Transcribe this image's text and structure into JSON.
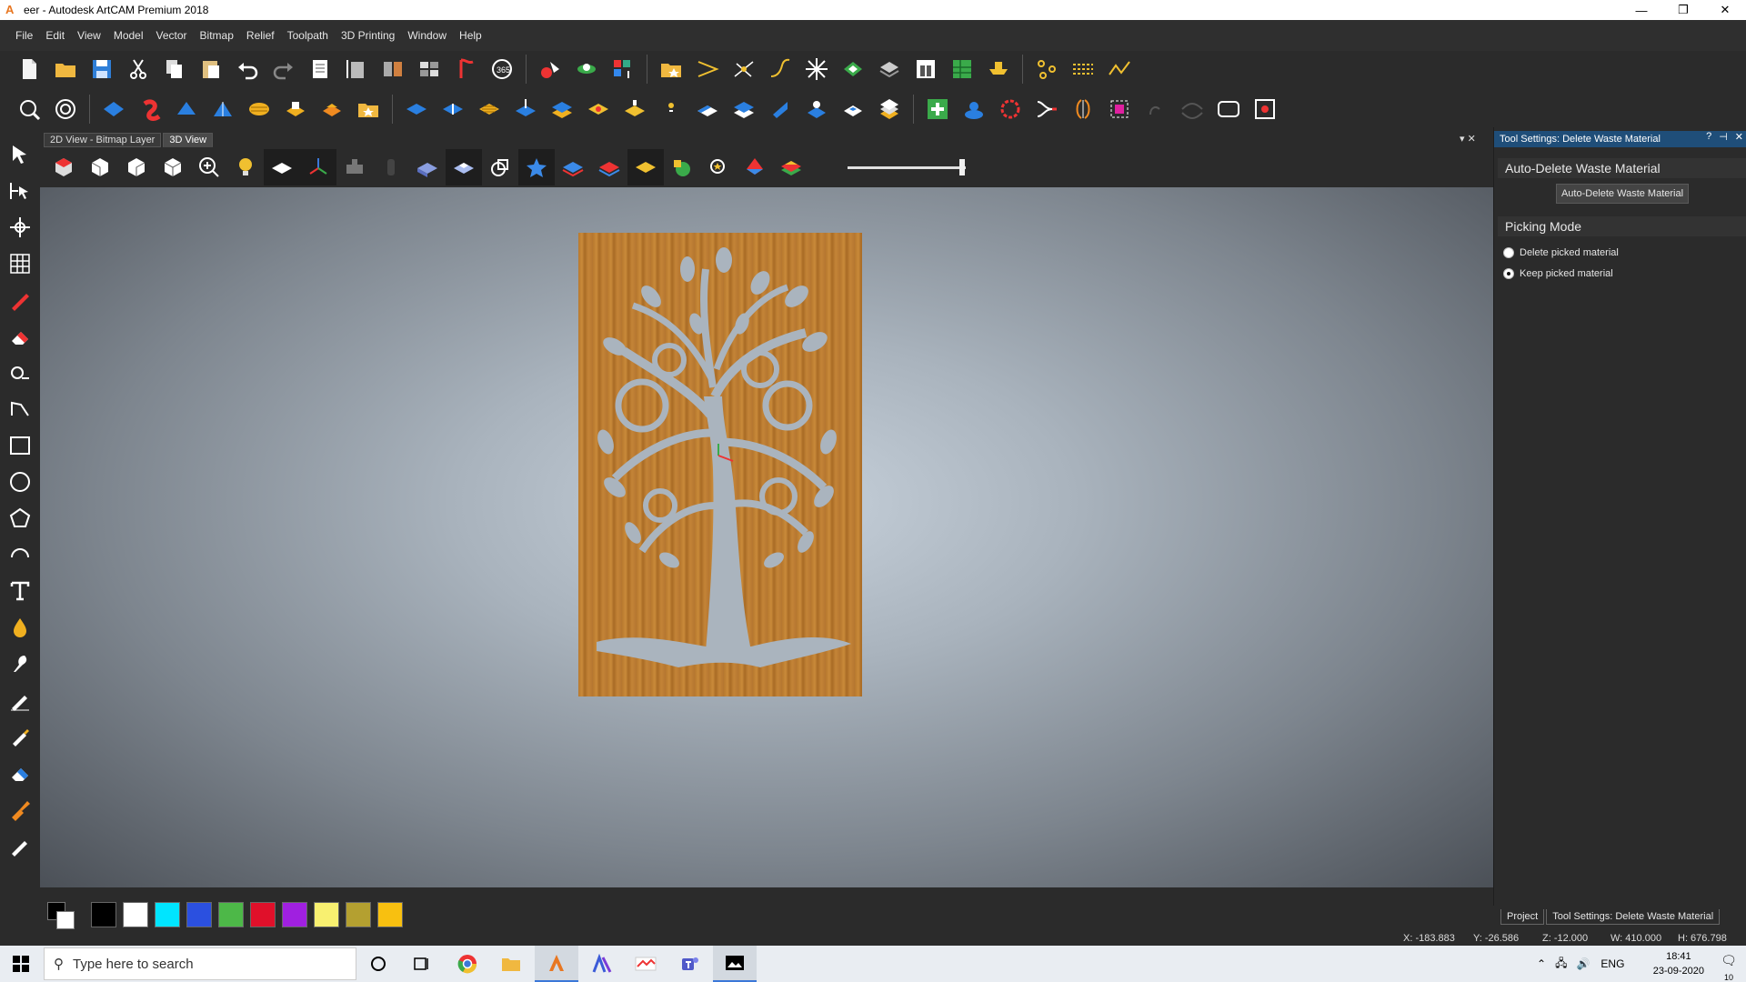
{
  "window": {
    "title": "eer - Autodesk ArtCAM Premium 2018",
    "minimize": "—",
    "restore": "❐",
    "close": "✕"
  },
  "menu": [
    "File",
    "Edit",
    "View",
    "Model",
    "Vector",
    "Bitmap",
    "Relief",
    "Toolpath",
    "3D Printing",
    "Window",
    "Help"
  ],
  "view_tabs": {
    "tab_2d": "2D View - Bitmap Layer",
    "tab_3d": "3D View"
  },
  "viewport": {
    "panel_colors": {
      "wood": "#c48437",
      "cutout": "#aab4be"
    }
  },
  "palette": {
    "colors": [
      "#000000",
      "#ffffff",
      "#00e5ff",
      "#2b50e0",
      "#4db848",
      "#e0102a",
      "#a020e0",
      "#f8f070",
      "#b4a030",
      "#f8c010"
    ]
  },
  "right_panel": {
    "header": "Tool Settings: Delete Waste Material",
    "header_buttons": [
      "?",
      "⊣",
      "✕"
    ],
    "pin_buttons": [
      "▾",
      "✕"
    ],
    "section_auto": "Auto-Delete Waste Material",
    "auto_button": "Auto-Delete Waste Material",
    "section_picking": "Picking Mode",
    "option_delete": "Delete picked material",
    "option_keep": "Keep picked material",
    "selected_option": "Keep picked material"
  },
  "panel_tabs": {
    "project": "Project",
    "tool_settings": "Tool Settings: Delete Waste Material"
  },
  "status": {
    "x": "X: -183.883",
    "y": "Y: -26.586",
    "z": "Z: -12.000",
    "w": "W: 410.000",
    "h": "H: 676.798"
  },
  "taskbar": {
    "search_placeholder": "Type here to search",
    "language": "ENG",
    "time": "18:41",
    "date": "23-09-2020",
    "notification_count": "10"
  }
}
